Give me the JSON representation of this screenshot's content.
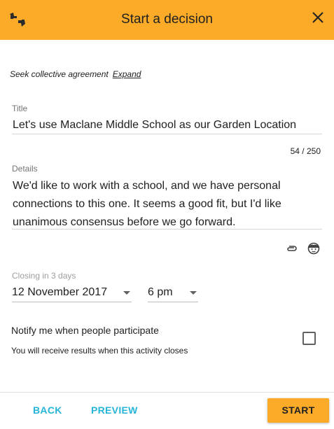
{
  "header": {
    "title": "Start a decision",
    "logo_icon": "thumbs-logo-icon",
    "close_icon": "close-icon",
    "background": "#fbab28"
  },
  "seek": {
    "text": "Seek collective agreement",
    "expand_label": "Expand"
  },
  "title_field": {
    "label": "Title",
    "value": "Let's use Maclane Middle School as our Garden Location",
    "counter": "54 / 250"
  },
  "details_field": {
    "label": "Details",
    "lines": [
      "We'd like to work with a school, and we have personal",
      "connections to this one.  It seems a good fit, but I'd like",
      "unanimous consensus before we go forward."
    ],
    "attach_icon": "paperclip-icon",
    "emoji_icon": "emoji-icon"
  },
  "closing": {
    "label": "Closing in 3 days",
    "date": "12 November 2017",
    "time": "6 pm"
  },
  "notify": {
    "label": "Notify me when people participate",
    "sublabel": "You will receive results when this activity closes",
    "checked": false
  },
  "footer": {
    "back_label": "BACK",
    "preview_label": "PREVIEW",
    "start_label": "START",
    "link_color": "#26b5d8",
    "accent": "#fbab28"
  }
}
